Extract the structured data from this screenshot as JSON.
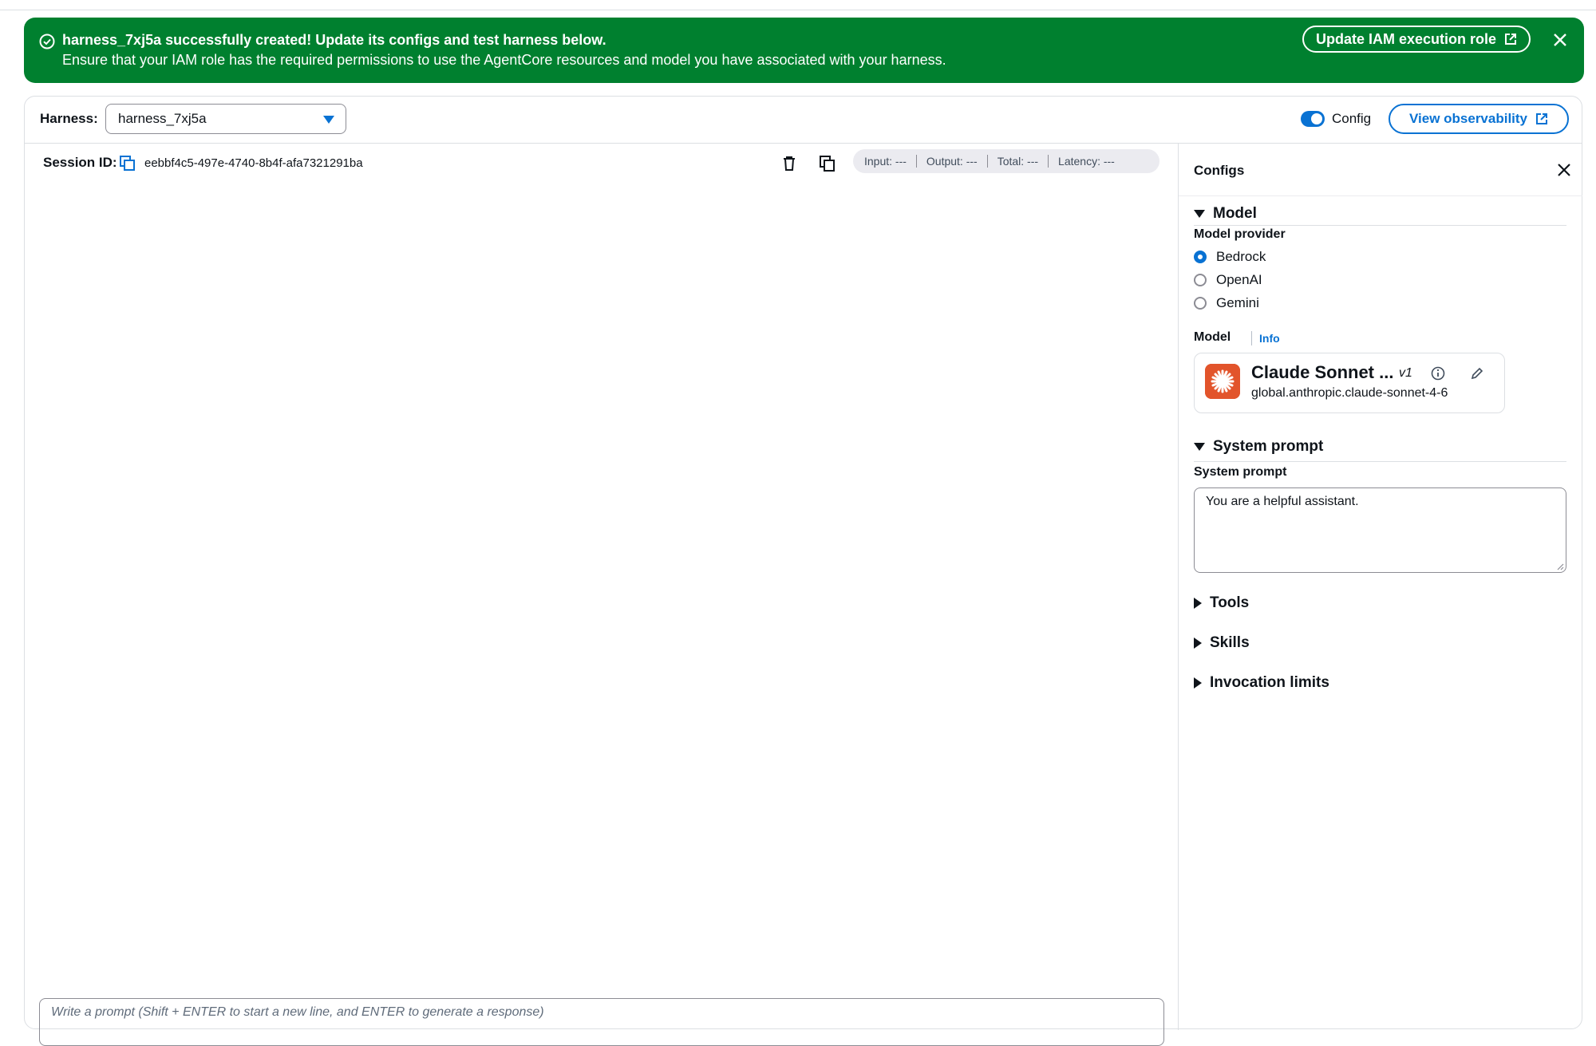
{
  "flash": {
    "title": "harness_7xj5a successfully created! Update its configs and test harness below.",
    "message": "Ensure that your IAM role has the required permissions to use the AgentCore resources and model you have associated with your harness.",
    "button_label": "Update IAM execution role",
    "color": "#00802f"
  },
  "header": {
    "harness_label": "Harness:",
    "harness_value": "harness_7xj5a",
    "config_toggle_label": "Config",
    "observability_button": "View observability"
  },
  "chat": {
    "session_label": "Session ID:",
    "session_id": "eebbf4c5-497e-4740-8b4f-afa7321291ba",
    "stats": {
      "input": "Input: ---",
      "output": "Output: ---",
      "total": "Total: ---",
      "latency": "Latency: ---"
    },
    "prompt_placeholder": "Write a prompt (Shift + ENTER to start a new line, and ENTER to generate a response)"
  },
  "configs": {
    "title": "Configs",
    "model_section": "Model",
    "model_provider_label": "Model provider",
    "providers": [
      "Bedrock",
      "OpenAI",
      "Gemini"
    ],
    "selected_provider": "Bedrock",
    "model_label": "Model",
    "info_link": "Info",
    "model_name": "Claude Sonnet ...",
    "model_version": "v1",
    "model_id": "global.anthropic.claude-sonnet-4-6",
    "system_prompt_section": "System prompt",
    "system_prompt_label": "System prompt",
    "system_prompt_value": "You are a helpful assistant.",
    "tools_section": "Tools",
    "skills_section": "Skills",
    "invocation_limits_section": "Invocation limits"
  },
  "colors": {
    "accent": "#0972d3",
    "success": "#00802f",
    "model_logo": "#e2542b"
  }
}
